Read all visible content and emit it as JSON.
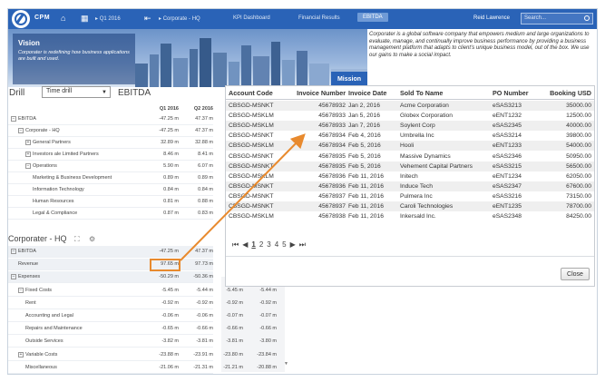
{
  "nav": {
    "brand": "CPM",
    "period": "Q1 2016",
    "entity": "Corporate - HQ",
    "items": [
      "KPI Dashboard",
      "Financial Results",
      "EBITDA"
    ],
    "user": "Reid Lawrence",
    "search_placeholder": "Search..."
  },
  "banner": {
    "vision_title": "Vision",
    "vision_text": "Corporater is redefining how business applications are built and used.",
    "mission_label": "Mission",
    "mission_text": "Corporater is a global software company that empowers medium and large organizations to evaluate, manage, and continually improve business performance by providing a business management platform that adapts to client's unique business model, out of the box. We use our gains to make a social impact."
  },
  "drill": {
    "label": "Drill",
    "select_value": "Time drill",
    "measure": "EBITDA",
    "columns": [
      "Q1 2016",
      "Q2 2016"
    ],
    "rows": [
      {
        "label": "EBITDA",
        "indent": 0,
        "expand": "-",
        "v1": "-47.25 m",
        "v2": "47.37 m"
      },
      {
        "label": "Corporate - HQ",
        "indent": 1,
        "expand": "-",
        "v1": "-47.25 m",
        "v2": "47.37 m"
      },
      {
        "label": "General Partners",
        "indent": 2,
        "expand": "+",
        "v1": "32.89 m",
        "v2": "32.88 m"
      },
      {
        "label": "Investors ale Limited Partners",
        "indent": 2,
        "expand": "+",
        "v1": "8.46 m",
        "v2": "8.41 m"
      },
      {
        "label": "Operations",
        "indent": 2,
        "expand": "-",
        "v1": "5.90 m",
        "v2": "6.07 m"
      },
      {
        "label": "Marketing & Business Development",
        "indent": 3,
        "expand": "",
        "v1": "0.89 m",
        "v2": "0.89 m"
      },
      {
        "label": "Information Technology",
        "indent": 3,
        "expand": "",
        "v1": "0.84 m",
        "v2": "0.84 m"
      },
      {
        "label": "Human Resources",
        "indent": 3,
        "expand": "",
        "v1": "0.81 m",
        "v2": "0.88 m"
      },
      {
        "label": "Legal & Compliance",
        "indent": 3,
        "expand": "",
        "v1": "0.87 m",
        "v2": "0.83 m"
      }
    ]
  },
  "section2": {
    "title": "Corporater - HQ",
    "icons": [
      "expand-icon",
      "settings-icon"
    ],
    "rows": [
      {
        "label": "EBITDA",
        "indent": 0,
        "expand": "-",
        "v1": "-47.25 m",
        "v2": "47.37 m",
        "v3": "",
        "v4": ""
      },
      {
        "label": "Revenue",
        "indent": 1,
        "expand": "",
        "v1": "97.65 m",
        "v2": "97.73 m",
        "v3": "",
        "v4": ""
      },
      {
        "label": "Expenses",
        "indent": 0,
        "expand": "-",
        "v1": "-50.29 m",
        "v2": "-50.36 m",
        "v3": "",
        "v4": ""
      },
      {
        "label": "Fixed Costs",
        "indent": 1,
        "expand": "-",
        "v1": "-5.45 m",
        "v2": "-5.44 m",
        "v3": "-5.45 m",
        "v4": "-5.44 m"
      },
      {
        "label": "Rent",
        "indent": 2,
        "expand": "",
        "v1": "-0.92 m",
        "v2": "-0.92 m",
        "v3": "-0.92 m",
        "v4": "-0.92 m"
      },
      {
        "label": "Accounting and Legal",
        "indent": 2,
        "expand": "",
        "v1": "-0.06 m",
        "v2": "-0.06 m",
        "v3": "-0.07 m",
        "v4": "-0.07 m"
      },
      {
        "label": "Repairs and Maintenance",
        "indent": 2,
        "expand": "",
        "v1": "-0.65 m",
        "v2": "-0.66 m",
        "v3": "-0.66 m",
        "v4": "-0.66 m"
      },
      {
        "label": "Outside Services",
        "indent": 2,
        "expand": "",
        "v1": "-3.82 m",
        "v2": "-3.81 m",
        "v3": "-3.81 m",
        "v4": "-3.80 m"
      },
      {
        "label": "Variable Costs",
        "indent": 1,
        "expand": "+",
        "v1": "-23.88 m",
        "v2": "-23.91 m",
        "v3": "-23.80 m",
        "v4": "-23.84 m"
      },
      {
        "label": "Miscellaneous",
        "indent": 2,
        "expand": "",
        "v1": "-21.06 m",
        "v2": "-21.31 m",
        "v3": "-21.21 m",
        "v4": "-20.88 m"
      }
    ]
  },
  "invoice_table": {
    "headers": [
      "Account Code",
      "Invoice Number",
      "Invoice Date",
      "Sold To Name",
      "PO Number",
      "Booking USD"
    ],
    "rows": [
      [
        "CBSGD-MSNKT",
        "45678932",
        "Jan 2, 2016",
        "Acme Corporation",
        "eSAS3213",
        "35000.00"
      ],
      [
        "CBSGD-MSKLM",
        "45678933",
        "Jan 5, 2016",
        "Globex Corporation",
        "eENT1232",
        "12500.00"
      ],
      [
        "CBSGD-MSKLM",
        "45678933",
        "Jan 7, 2016",
        "Soylent Corp",
        "eSAS2345",
        "40000.00"
      ],
      [
        "CBSGD-MSNKT",
        "45678934",
        "Feb 4, 2016",
        "Umbrella Inc",
        "eSAS3214",
        "39800.00"
      ],
      [
        "CBSGD-MSKLM",
        "45678934",
        "Feb 5, 2016",
        "Hooli",
        "eENT1233",
        "54000.00"
      ],
      [
        "CBSGD-MSNKT",
        "45678935",
        "Feb 5, 2016",
        "Massive Dynamics",
        "eSAS2346",
        "50950.00"
      ],
      [
        "CBSGD-MSNKT",
        "45678935",
        "Feb 5, 2016",
        "Vehement Capital Partners",
        "eSAS3215",
        "56500.00"
      ],
      [
        "CBSGD-MSKLM",
        "45678936",
        "Feb 11, 2016",
        "Initech",
        "eENT1234",
        "62050.00"
      ],
      [
        "CBSGD-MSNKT",
        "45678936",
        "Feb 11, 2016",
        "Induce Tech",
        "eSAS2347",
        "67600.00"
      ],
      [
        "CBSGD-MSNKT",
        "45678937",
        "Feb 11, 2016",
        "Pulmera Inc",
        "eSAS3216",
        "73150.00"
      ],
      [
        "CBSGD-MSNKT",
        "45678937",
        "Feb 11, 2016",
        "Caroli Technologies",
        "eENT1235",
        "78700.00"
      ],
      [
        "CBSGD-MSKLM",
        "45678938",
        "Feb 11, 2016",
        "Inkersald Inc.",
        "eSAS2348",
        "84250.00"
      ]
    ],
    "pager": {
      "first": "⏮",
      "prev": "◀",
      "pages": [
        "1",
        "2",
        "3",
        "4",
        "5"
      ],
      "current": "1",
      "next": "▶",
      "last": "⏭"
    },
    "close_label": "Close"
  },
  "colors": {
    "nav_blue": "#2a63b7",
    "highlight_orange": "#e88a2e"
  }
}
